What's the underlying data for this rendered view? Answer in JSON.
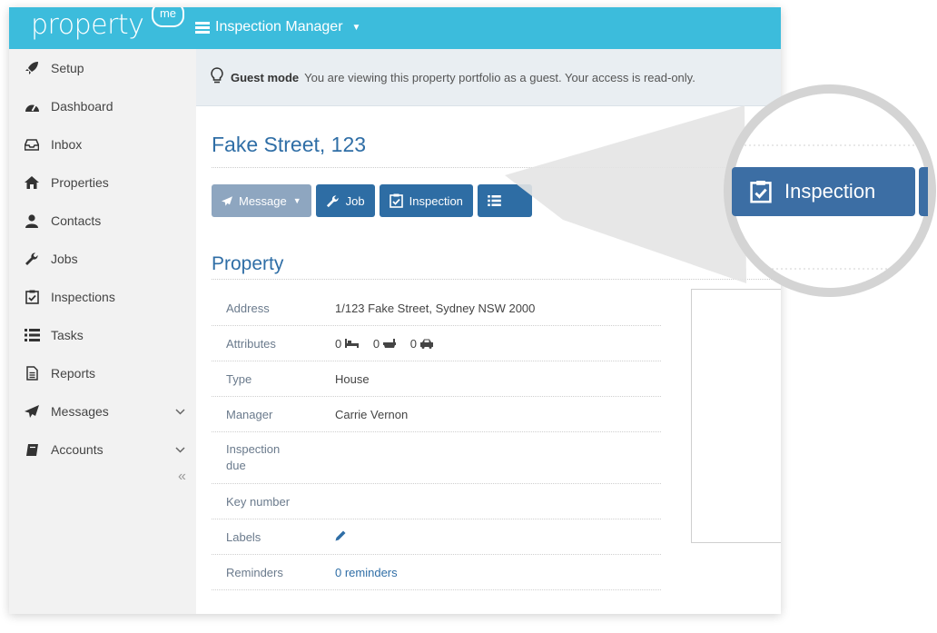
{
  "header": {
    "logo_text": "property",
    "logo_badge": "me",
    "app_menu": "Inspection Manager"
  },
  "sidebar": {
    "items": [
      {
        "label": "Setup",
        "icon": "rocket-icon"
      },
      {
        "label": "Dashboard",
        "icon": "dashboard-icon"
      },
      {
        "label": "Inbox",
        "icon": "inbox-icon"
      },
      {
        "label": "Properties",
        "icon": "home-icon"
      },
      {
        "label": "Contacts",
        "icon": "user-icon"
      },
      {
        "label": "Jobs",
        "icon": "wrench-icon"
      },
      {
        "label": "Inspections",
        "icon": "clipboard-check-icon"
      },
      {
        "label": "Tasks",
        "icon": "list-icon"
      },
      {
        "label": "Reports",
        "icon": "document-icon"
      },
      {
        "label": "Messages",
        "icon": "paper-plane-icon"
      },
      {
        "label": "Accounts",
        "icon": "book-icon"
      }
    ]
  },
  "guest": {
    "label": "Guest mode",
    "message": "You are viewing this property portfolio as a guest. Your access is read-only."
  },
  "page": {
    "title": "Fake Street, 123",
    "section_title": "Property"
  },
  "actions": {
    "message": "Message",
    "job": "Job",
    "inspection": "Inspection"
  },
  "property": {
    "address_label": "Address",
    "address": "1/123 Fake Street, Sydney NSW 2000",
    "attributes_label": "Attributes",
    "bedrooms": "0",
    "bathrooms": "0",
    "parking": "0",
    "type_label": "Type",
    "type": "House",
    "manager_label": "Manager",
    "manager": "Carrie Vernon",
    "inspection_due_label": "Inspection due",
    "key_number_label": "Key number",
    "labels_label": "Labels",
    "reminders_label": "Reminders",
    "reminders": "0 reminders"
  },
  "zoom": {
    "label": "Inspection"
  },
  "colors": {
    "topbar": "#3cbcdc",
    "primary": "#2e6da4",
    "muted_button": "#8ea6c0",
    "title": "#2f6ea6"
  }
}
